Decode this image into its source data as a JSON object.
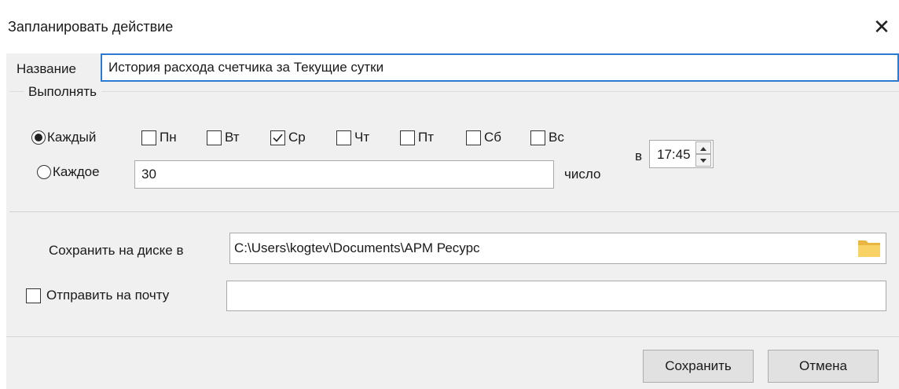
{
  "dialog": {
    "title": "Запланировать действие"
  },
  "name_field": {
    "label": "Название",
    "value": "История расхода счетчика за Текущие сутки"
  },
  "schedule": {
    "group_label": "Выполнять",
    "every_label": "Каждый",
    "every_selected": true,
    "days": [
      {
        "label": "Пн",
        "checked": false
      },
      {
        "label": "Вт",
        "checked": false
      },
      {
        "label": "Ср",
        "checked": true
      },
      {
        "label": "Чт",
        "checked": false
      },
      {
        "label": "Пт",
        "checked": false
      },
      {
        "label": "Сб",
        "checked": false
      },
      {
        "label": "Вс",
        "checked": false
      }
    ],
    "each_label": "Каждое",
    "each_selected": false,
    "day_number": "30",
    "number_label": "число",
    "at_label": "в",
    "time": "17:45"
  },
  "save_path": {
    "label": "Сохранить на диске в",
    "value": "C:\\Users\\kogtev\\Documents\\АРМ Ресурс",
    "icon": "folder-icon"
  },
  "email": {
    "label": "Отправить на почту",
    "checked": false,
    "value": ""
  },
  "buttons": {
    "save": "Сохранить",
    "cancel": "Отмена"
  }
}
